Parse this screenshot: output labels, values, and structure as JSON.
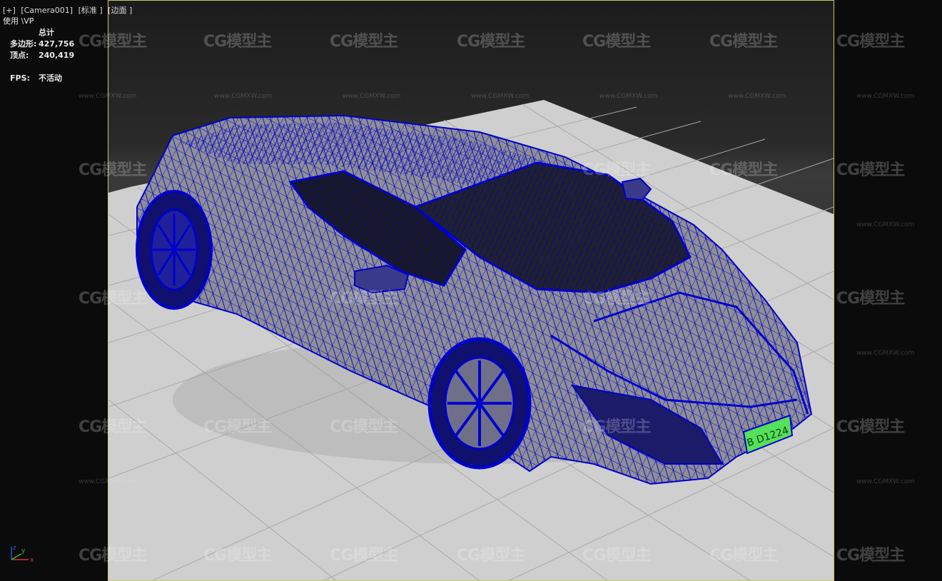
{
  "viewport": {
    "label_items": [
      "[+]",
      "[Camera001]",
      "[标准 ]",
      "[边面 ]"
    ],
    "use_label": "使用 \\VP"
  },
  "stats": {
    "header": "总计",
    "polygons_label": "多边形:",
    "polygons_value": "427,756",
    "vertices_label": "顶点:",
    "vertices_value": "240,419",
    "fps_label": "FPS:",
    "fps_value": "不活动"
  },
  "watermark": {
    "logo_text": "CG模型主",
    "url_text": "www.CGMXW.com"
  },
  "axis": {
    "x": "x",
    "y": "y",
    "z": "z"
  },
  "plate": {
    "text": "B D1224"
  },
  "colors": {
    "wire": "#0000cc",
    "ground": "#cfcfcf",
    "frame_highlight": "#c8c86a",
    "plate": "#55e05a"
  }
}
